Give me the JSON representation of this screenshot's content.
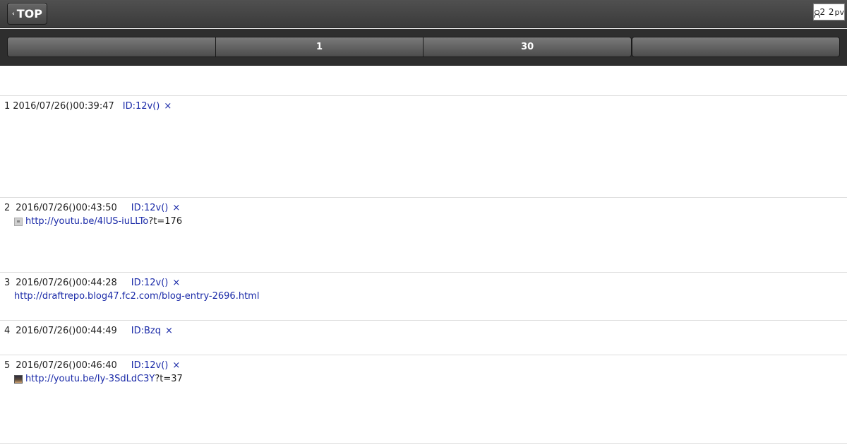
{
  "topbar": {
    "back_label": "TOP",
    "back_icon": "chevron-left-icon",
    "pv_count_users": "2",
    "pv_count_views": "2",
    "pv_unit": "pv"
  },
  "nav": {
    "segments": [
      "",
      "1",
      "30"
    ],
    "last_label": ""
  },
  "posts": [
    {
      "num": "1",
      "date": "2016/07/26()00:39:47",
      "id": "ID:12v()",
      "x": "×"
    },
    {
      "num": "2",
      "date": "2016/07/26()00:43:50",
      "id": "ID:12v()",
      "x": "×",
      "link_text": "http://youtu.be/4lUS-iuLLTo",
      "link_suffix": "?t=176"
    },
    {
      "num": "3",
      "date": "2016/07/26()00:44:28",
      "id": "ID:12v()",
      "x": "×",
      "link_text": "http://draftrepo.blog47.fc2.com/blog-entry-2696.html"
    },
    {
      "num": "4",
      "date": "2016/07/26()00:44:49",
      "id": "ID:Bzq",
      "x": "×"
    },
    {
      "num": "5",
      "date": "2016/07/26()00:46:40",
      "id": "ID:12v()",
      "x": "×",
      "link_text": "http://youtu.be/Iy-3SdLdC3Y",
      "link_suffix": "?t=37"
    }
  ],
  "colors": {
    "link": "#1a2aa8",
    "topbar": "#444444",
    "navbar": "#2e2e2e"
  }
}
